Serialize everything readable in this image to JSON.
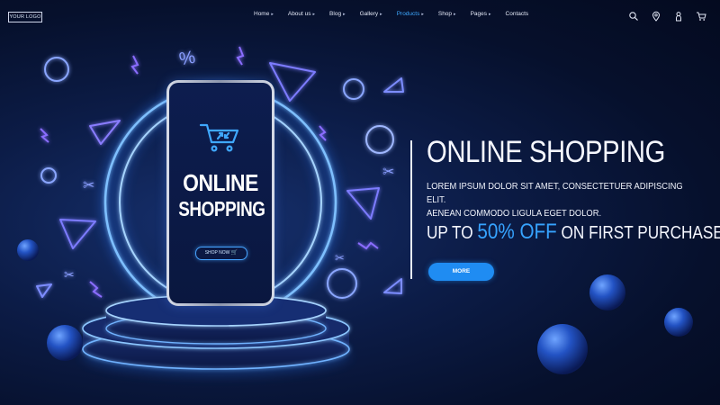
{
  "logo": {
    "text": "YOUR LOGO"
  },
  "nav": {
    "items": [
      {
        "label": "Home",
        "caret": "▸",
        "active": false
      },
      {
        "label": "About us",
        "caret": "▸",
        "active": false
      },
      {
        "label": "Blog",
        "caret": "▸",
        "active": false
      },
      {
        "label": "Gallery",
        "caret": "▸",
        "active": false
      },
      {
        "label": "Products",
        "caret": "▸",
        "active": true
      },
      {
        "label": "Shop",
        "caret": "▸",
        "active": false
      },
      {
        "label": "Pages",
        "caret": "▸",
        "active": false
      },
      {
        "label": "Contacts",
        "caret": "",
        "active": false
      }
    ],
    "icons": [
      "search-icon",
      "location-icon",
      "user-icon",
      "cart-icon"
    ]
  },
  "phone": {
    "title_line1": "ONLINE",
    "title_line2": "SHOPPING",
    "button": "SHOP NOW"
  },
  "hero": {
    "headline": "ONLINE SHOPPING",
    "desc_line1": "LOREM IPSUM DOLOR SIT AMET, CONSECTETUER ADIPISCING ELIT.",
    "desc_line2": "AENEAN COMMODO LIGULA EGET DOLOR.",
    "promo_prefix": "UP TO",
    "promo_accent": "50% OFF",
    "promo_suffix": "ON FIRST PURCHASE",
    "more_button": "MORE"
  },
  "colors": {
    "accent": "#36a3ff",
    "button": "#1f8cf2",
    "background": "#0c1c47"
  }
}
